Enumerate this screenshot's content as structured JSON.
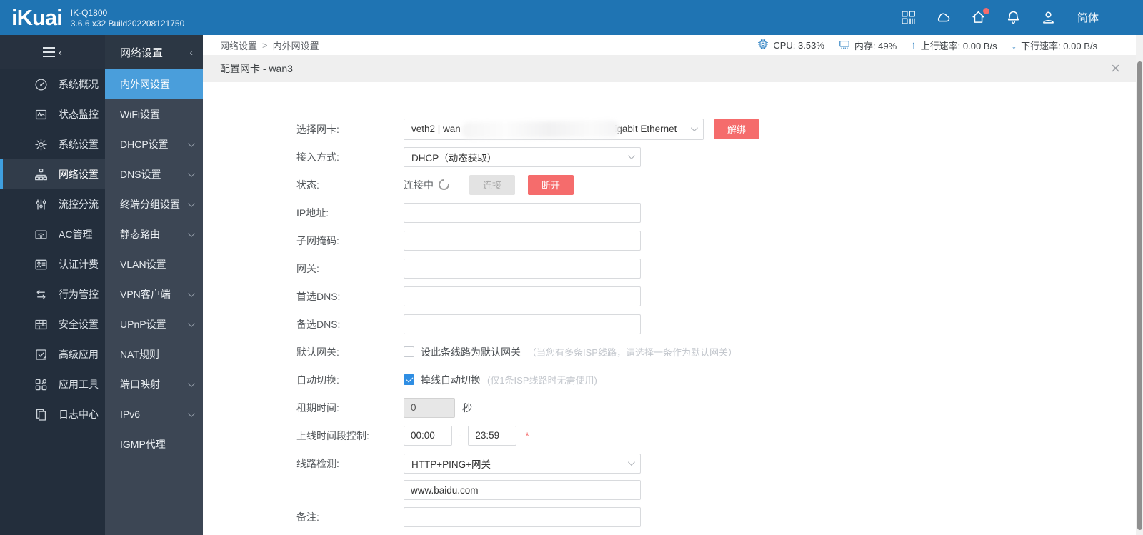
{
  "topbar": {
    "logo": "iKuai",
    "model": "IK-Q1800",
    "version": "3.6.6 x32 Build202208121750",
    "language": "简体",
    "icons": [
      {
        "id": "apps",
        "badge": false
      },
      {
        "id": "cloud",
        "badge": false
      },
      {
        "id": "home",
        "badge": true
      },
      {
        "id": "bell",
        "badge": false
      },
      {
        "id": "user",
        "badge": false
      }
    ]
  },
  "sidebar": {
    "items": [
      {
        "id": "system-overview",
        "icon": "gauge",
        "label": "系统概况",
        "active": false
      },
      {
        "id": "status-monitor",
        "icon": "monitor",
        "label": "状态监控",
        "active": false
      },
      {
        "id": "system-settings",
        "icon": "gear",
        "label": "系统设置",
        "active": false
      },
      {
        "id": "network-settings",
        "icon": "network",
        "label": "网络设置",
        "active": true
      },
      {
        "id": "flow-control",
        "icon": "sliders",
        "label": "流控分流",
        "active": false
      },
      {
        "id": "ac-management",
        "icon": "wifi",
        "label": "AC管理",
        "active": false
      },
      {
        "id": "auth-billing",
        "icon": "idcard",
        "label": "认证计费",
        "active": false
      },
      {
        "id": "behavior-control",
        "icon": "arrows",
        "label": "行为管控",
        "active": false
      },
      {
        "id": "security-settings",
        "icon": "wall",
        "label": "安全设置",
        "active": false
      },
      {
        "id": "advanced-apps",
        "icon": "doc-check",
        "label": "高级应用",
        "active": false
      },
      {
        "id": "app-tools",
        "icon": "tools",
        "label": "应用工具",
        "active": false
      },
      {
        "id": "log-center",
        "icon": "logs",
        "label": "日志中心",
        "active": false
      }
    ]
  },
  "submenu": {
    "title": "网络设置",
    "items": [
      {
        "id": "wan-lan-settings",
        "label": "内外网设置",
        "active": true,
        "expandable": false
      },
      {
        "id": "wifi-settings",
        "label": "WiFi设置",
        "active": false,
        "expandable": false
      },
      {
        "id": "dhcp-settings",
        "label": "DHCP设置",
        "active": false,
        "expandable": true
      },
      {
        "id": "dns-settings",
        "label": "DNS设置",
        "active": false,
        "expandable": true
      },
      {
        "id": "terminal-group-settings",
        "label": "终端分组设置",
        "active": false,
        "expandable": true
      },
      {
        "id": "static-route",
        "label": "静态路由",
        "active": false,
        "expandable": true
      },
      {
        "id": "vlan-settings",
        "label": "VLAN设置",
        "active": false,
        "expandable": false
      },
      {
        "id": "vpn-client",
        "label": "VPN客户端",
        "active": false,
        "expandable": true
      },
      {
        "id": "upnp-settings",
        "label": "UPnP设置",
        "active": false,
        "expandable": true
      },
      {
        "id": "nat-rules",
        "label": "NAT规则",
        "active": false,
        "expandable": false
      },
      {
        "id": "port-mapping",
        "label": "端口映射",
        "active": false,
        "expandable": true
      },
      {
        "id": "ipv6",
        "label": "IPv6",
        "active": false,
        "expandable": true
      },
      {
        "id": "igmp-proxy",
        "label": "IGMP代理",
        "active": false,
        "expandable": false
      }
    ]
  },
  "statusbar": {
    "breadcrumb_parent": "网络设置",
    "breadcrumb_sep": ">",
    "breadcrumb_current": "内外网设置",
    "cpu": "CPU: 3.53%",
    "memory": "内存: 49%",
    "up_arrow": "↑",
    "upload": "上行速率: 0.00 B/s",
    "down_arrow": "↓",
    "download": "下行速率: 0.00 B/s"
  },
  "panel": {
    "title": "配置网卡 - wan3",
    "close": "×"
  },
  "form": {
    "nic_label": "选择网卡:",
    "nic_prefix": "veth2 | wan",
    "nic_suffix": "Gigabit Ethernet",
    "unbind": "解绑",
    "access_label": "接入方式:",
    "access_value": "DHCP（动态获取）",
    "status_label": "状态:",
    "status_text": "连接中",
    "connect": "连接",
    "disconnect": "断开",
    "ip_label": "IP地址:",
    "mask_label": "子网掩码:",
    "gateway_label": "网关:",
    "dns1_label": "首选DNS:",
    "dns2_label": "备选DNS:",
    "default_gw_label": "默认网关:",
    "default_gw_checkbox": "设此条线路为默认网关",
    "default_gw_hint": "（当您有多条ISP线路，请选择一条作为默认网关）",
    "auto_switch_label": "自动切换:",
    "auto_switch_checkbox": "掉线自动切换",
    "auto_switch_hint": "(仅1条ISP线路时无需使用)",
    "lease_label": "租期时间:",
    "lease_value": "0",
    "lease_unit": "秒",
    "schedule_label": "上线时间段控制:",
    "schedule_start": "00:00",
    "schedule_sep": "-",
    "schedule_end": "23:59",
    "schedule_required": "*",
    "detect_label": "线路检测:",
    "detect_value": "HTTP+PING+网关",
    "detect_url": "www.baidu.com",
    "remark_label": "备注:"
  },
  "colors": {
    "topbar_blue": "#1f74b3",
    "sidebar_dark": "#232e3c",
    "submenu_gray": "#3c4654",
    "selected_blue": "#4a9edb",
    "accent_blue": "#3f9fdf",
    "danger_red": "#f56c6c",
    "checkbox_blue": "#2f8ee3"
  }
}
